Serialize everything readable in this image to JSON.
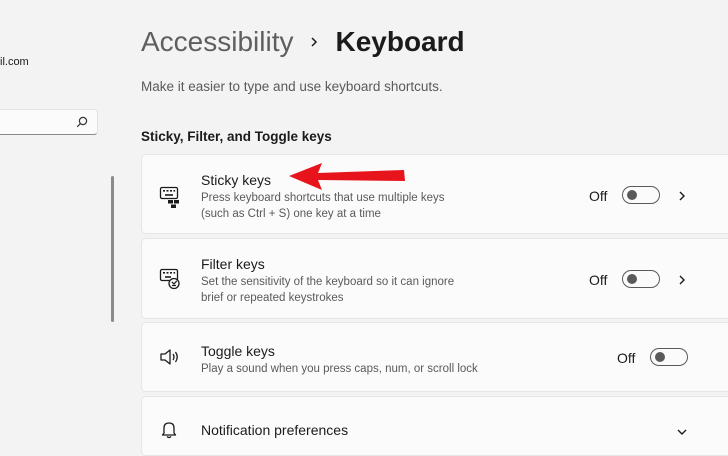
{
  "sidebar": {
    "email_fragment": "il.com",
    "search_icon": "search-icon"
  },
  "header": {
    "parent": "Accessibility",
    "separator_icon": "chevron-right-icon",
    "current": "Keyboard"
  },
  "subtitle": "Make it easier to type and use keyboard shortcuts.",
  "section_title": "Sticky, Filter, and Toggle keys",
  "cards": {
    "sticky": {
      "icon": "sticky-keys-icon",
      "title": "Sticky keys",
      "desc_line1": "Press keyboard shortcuts that use multiple keys",
      "desc_line2": "(such as Ctrl + S) one key at a time",
      "state": "Off",
      "toggle_on": false
    },
    "filter": {
      "icon": "filter-keys-icon",
      "title": "Filter keys",
      "desc_line1": "Set the sensitivity of the keyboard so it can ignore",
      "desc_line2": "brief or repeated keystrokes",
      "state": "Off",
      "toggle_on": false
    },
    "toggle": {
      "icon": "speaker-icon",
      "title": "Toggle keys",
      "desc_line1": "Play a sound when you press caps, num, or scroll lock",
      "state": "Off",
      "toggle_on": false
    },
    "notification": {
      "icon": "bell-icon",
      "title": "Notification preferences"
    }
  },
  "colors": {
    "annotation_arrow": "#e8141b",
    "background": "#f3f3f3",
    "card": "#fbfbfb"
  }
}
